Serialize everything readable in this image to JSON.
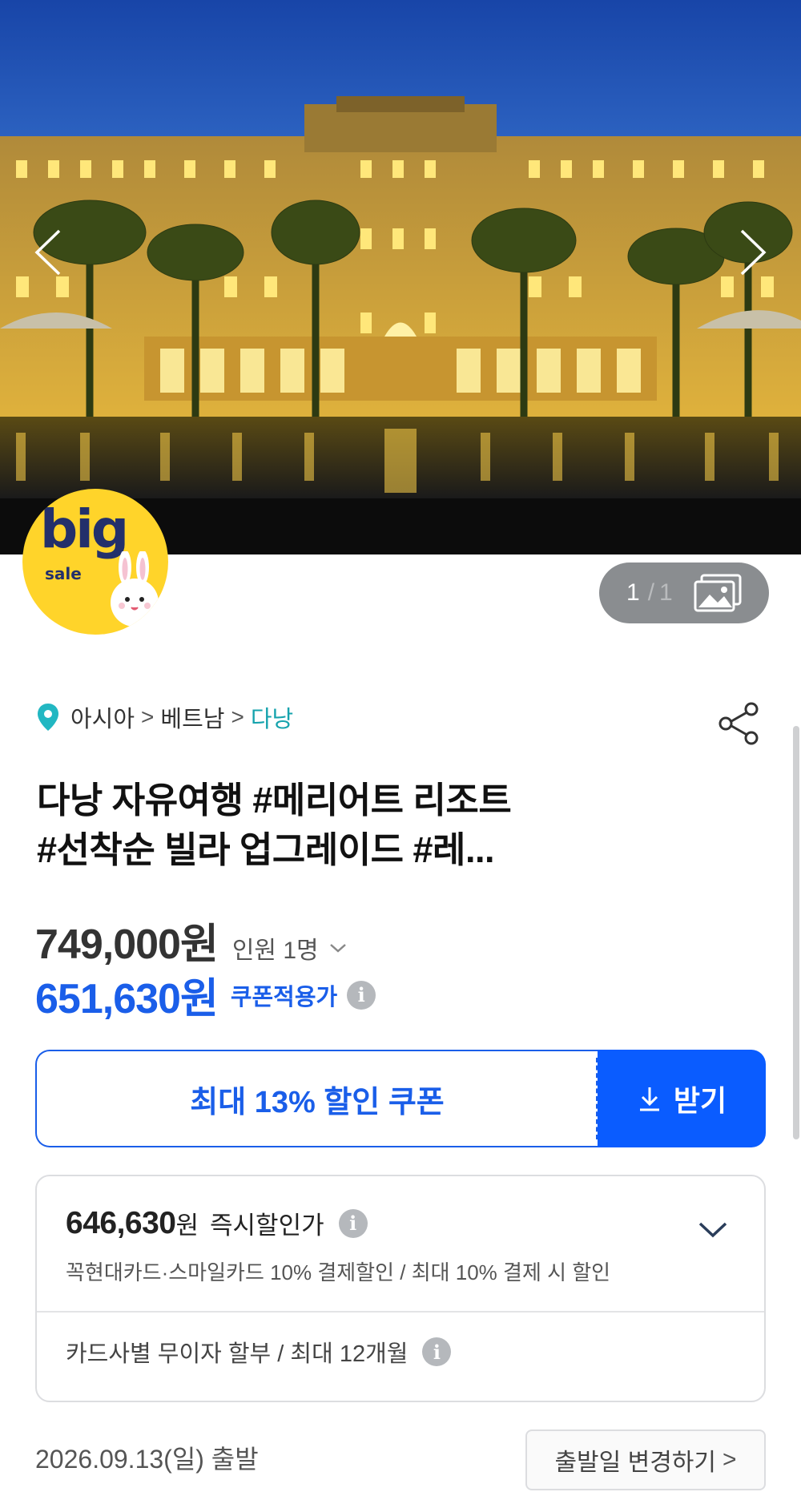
{
  "hero": {
    "prev_icon": "chevron-left-icon",
    "next_icon": "chevron-right-icon"
  },
  "badge": {
    "big": "big",
    "sale": "sale"
  },
  "gallery_counter": {
    "current": "1",
    "separator": "/",
    "total": "1",
    "icon": "gallery-icon"
  },
  "breadcrumb": {
    "items": [
      {
        "label": "아시아"
      },
      {
        "label": "베트남"
      },
      {
        "label": "다낭"
      }
    ],
    "separator": ">"
  },
  "product": {
    "title_line1": "다낭 자유여행 #메리어트 리조트",
    "title_line2": "#선착순 빌라 업그레이드 #레..."
  },
  "pricing": {
    "price": "749,000원",
    "pax": "인원 1명",
    "coupon_price": "651,630원",
    "coupon_label": "쿠폰적용가"
  },
  "coupon": {
    "prefix": "최대 ",
    "percent": "13%",
    "suffix": " 할인 쿠폰",
    "get_label": "받기"
  },
  "payment": {
    "price": "646,630",
    "unit": "원",
    "label": "즉시할인가",
    "desc": "꼭현대카드·스마일카드 10% 결제할인 / 최대 10% 결제 시 할인",
    "installment": "카드사별 무이자 할부 / 최대 12개월"
  },
  "departure": {
    "date_text": "2026.09.13(일) 출발",
    "change_label": "출발일 변경하기",
    "change_arrow": ">"
  },
  "colors": {
    "accent": "#1a5ee9",
    "button": "#0a5cff",
    "teal": "#16a3ad",
    "badge": "#ffd42a"
  }
}
